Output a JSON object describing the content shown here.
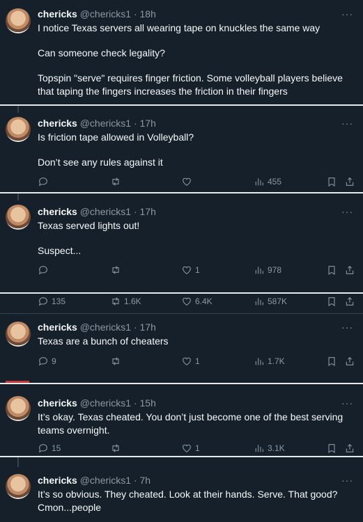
{
  "tweets": [
    {
      "name": "chericks",
      "handle": "@chericks1",
      "dot": "·",
      "time": "18h",
      "lines": [
        "I notice Texas servers all wearing tape on knuckles the same way",
        "Can someone check legality?",
        "Topspin \"serve\" requires finger friction. Some volleyball players believe that taping the fingers increases the friction in their fingers"
      ]
    },
    {
      "name": "chericks",
      "handle": "@chericks1",
      "dot": "·",
      "time": "17h",
      "lines": [
        "Is friction tape allowed in Volleyball?",
        "Don’t see any rules against it"
      ],
      "replies": "",
      "retweets": "",
      "likes": "",
      "views": "455"
    },
    {
      "name": "chericks",
      "handle": "@chericks1",
      "dot": "·",
      "time": "17h",
      "lines": [
        "Texas served lights out!",
        "Suspect..."
      ],
      "replies": "",
      "retweets": "",
      "likes": "1",
      "views": "978"
    },
    {
      "replies": "135",
      "retweets": "1.6K",
      "likes": "6.4K",
      "views": "587K"
    },
    {
      "name": "chericks",
      "handle": "@chericks1",
      "dot": "·",
      "time": "17h",
      "lines": [
        "Texas are a bunch of cheaters"
      ],
      "replies": "9",
      "retweets": "",
      "likes": "1",
      "views": "1.7K"
    },
    {
      "name": "chericks",
      "handle": "@chericks1",
      "dot": "·",
      "time": "15h",
      "lines": [
        "It’s okay. Texas cheated. You don’t just become one of the best serving teams overnight."
      ],
      "replies": "15",
      "retweets": "",
      "likes": "1",
      "views": "3.1K"
    },
    {
      "name": "chericks",
      "handle": "@chericks1",
      "dot": "·",
      "time": "7h",
      "lines": [
        "It’s so obvious. They cheated. Look at their hands. Serve. That good? Cmon...people"
      ]
    }
  ],
  "more_glyph": "···",
  "icons": [
    "reply-icon",
    "retweet-icon",
    "like-icon",
    "views-icon",
    "bookmark-icon",
    "share-icon"
  ],
  "colors": {
    "background": "#15202b",
    "text": "#f7f9f9",
    "muted": "#8b98a5",
    "separator": "#e7e9ea"
  }
}
